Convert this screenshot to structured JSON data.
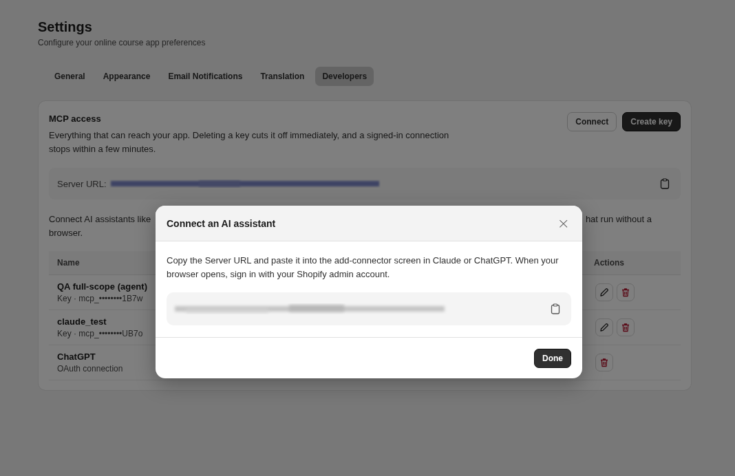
{
  "page": {
    "title": "Settings",
    "subtitle": "Configure your online course app preferences"
  },
  "tabs": [
    {
      "label": "General",
      "selected": false
    },
    {
      "label": "Appearance",
      "selected": false
    },
    {
      "label": "Email Notifications",
      "selected": false
    },
    {
      "label": "Translation",
      "selected": false
    },
    {
      "label": "Developers",
      "selected": true
    }
  ],
  "mcp_card": {
    "title": "MCP access",
    "description": "Everything that can reach your app. Deleting a key cuts it off immediately, and a signed-in connection stops within a few minutes.",
    "buttons": [
      {
        "label": "Connect",
        "kind": "secondary"
      },
      {
        "label": "Create key",
        "kind": "primary"
      }
    ],
    "server_url_label": "Server URL:",
    "connect_text_left": "Connect AI assistants like",
    "connect_text_right": "hat run without a",
    "connect_text_line2": "browser."
  },
  "table": {
    "columns": [
      "Name",
      "Actions"
    ],
    "rows": [
      {
        "name": "QA full-scope (agent)",
        "detail": "Key · mcp_••••••••1B7w",
        "actions": [
          {
            "kind": "edit"
          },
          {
            "kind": "delete"
          }
        ]
      },
      {
        "name": "claude_test",
        "detail": "Key · mcp_••••••••UB7o",
        "actions": [
          {
            "kind": "edit"
          },
          {
            "kind": "delete"
          }
        ]
      },
      {
        "name": "ChatGPT",
        "detail": "OAuth connection",
        "actions": [
          {
            "kind": "delete"
          }
        ]
      }
    ]
  },
  "modal": {
    "title": "Connect an AI assistant",
    "close": "×",
    "body": "Copy the Server URL and paste it into the add-connector screen in Claude or ChatGPT. When your browser opens, sign in with your Shopify admin account.",
    "button": "Done"
  }
}
